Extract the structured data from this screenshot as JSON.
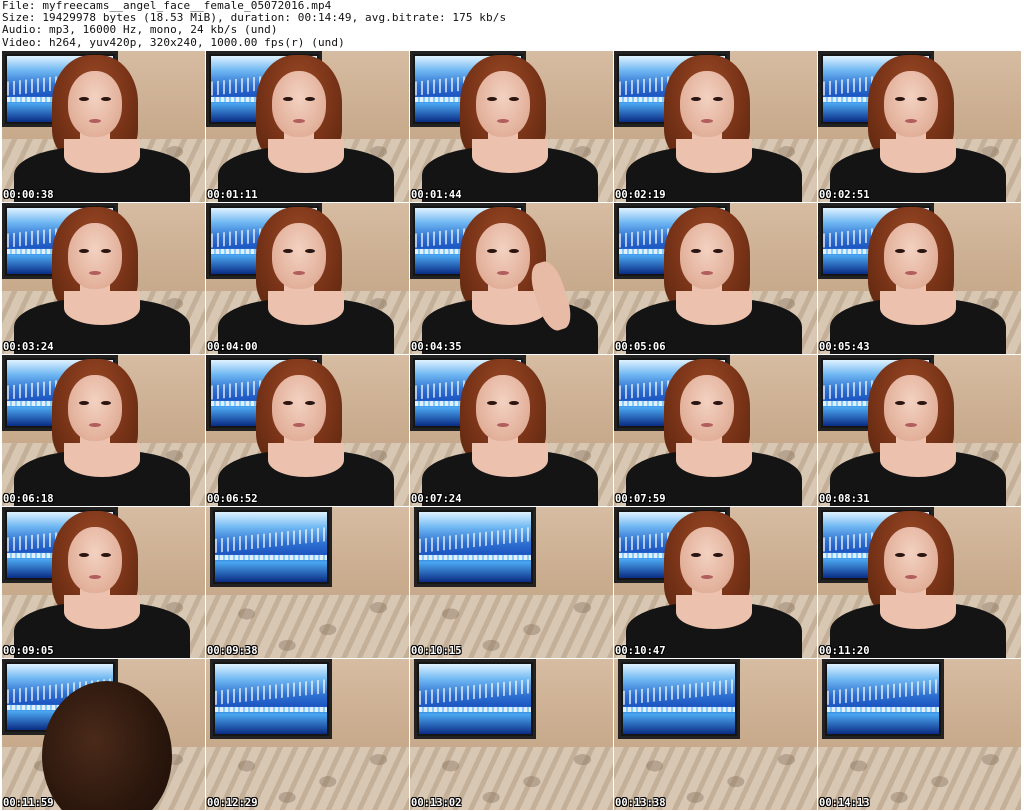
{
  "header": {
    "file_line": "File: myfreecams__angel_face__female_05072016.mp4",
    "size_line": "Size: 19429978 bytes (18.53 MiB), duration: 00:14:49, avg.bitrate: 175 kb/s",
    "audio_line": "Audio: mp3, 16000 Hz, mono, 24 kb/s (und)",
    "video_line": "Video: h264, yuv420p, 320x240, 1000.00 fps(r) (und)"
  },
  "thumbnails": [
    {
      "timestamp": "00:00:38",
      "scene": "person"
    },
    {
      "timestamp": "00:01:11",
      "scene": "person"
    },
    {
      "timestamp": "00:01:44",
      "scene": "person-print"
    },
    {
      "timestamp": "00:02:19",
      "scene": "person-print"
    },
    {
      "timestamp": "00:02:51",
      "scene": "person"
    },
    {
      "timestamp": "00:03:24",
      "scene": "person-print"
    },
    {
      "timestamp": "00:04:00",
      "scene": "person"
    },
    {
      "timestamp": "00:04:35",
      "scene": "person-arm"
    },
    {
      "timestamp": "00:05:06",
      "scene": "person-print"
    },
    {
      "timestamp": "00:05:43",
      "scene": "person-print"
    },
    {
      "timestamp": "00:06:18",
      "scene": "person"
    },
    {
      "timestamp": "00:06:52",
      "scene": "person"
    },
    {
      "timestamp": "00:07:24",
      "scene": "person"
    },
    {
      "timestamp": "00:07:59",
      "scene": "person-print"
    },
    {
      "timestamp": "00:08:31",
      "scene": "person-print"
    },
    {
      "timestamp": "00:09:05",
      "scene": "person"
    },
    {
      "timestamp": "00:09:38",
      "scene": "empty"
    },
    {
      "timestamp": "00:10:15",
      "scene": "empty"
    },
    {
      "timestamp": "00:10:47",
      "scene": "person"
    },
    {
      "timestamp": "00:11:20",
      "scene": "person"
    },
    {
      "timestamp": "00:11:59",
      "scene": "blur"
    },
    {
      "timestamp": "00:12:29",
      "scene": "empty"
    },
    {
      "timestamp": "00:13:02",
      "scene": "empty"
    },
    {
      "timestamp": "00:13:38",
      "scene": "empty"
    },
    {
      "timestamp": "00:14:13",
      "scene": "empty"
    }
  ]
}
